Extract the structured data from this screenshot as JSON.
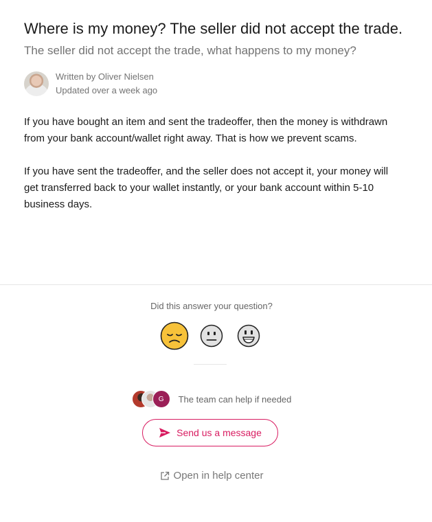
{
  "article": {
    "title": "Where is my money? The seller did not accept the trade.",
    "subtitle": "The seller did not accept the trade, what happens to my money?",
    "author_line": "Written by Oliver Nielsen",
    "updated_line": "Updated over a week ago",
    "paragraphs": [
      "If you have bought an item and sent the tradeoffer, then the money is withdrawn from your bank account/wallet right away. That is how we prevent scams.",
      "If you have sent the tradeoffer, and the seller does not accept it, your money will get transferred back to your wallet instantly, or your bank account within 5-10 business days."
    ]
  },
  "feedback": {
    "question": "Did this answer your question?",
    "options": [
      "disappointed-emoji",
      "neutral-emoji",
      "smiley-emoji"
    ]
  },
  "team": {
    "text": "The team can help if needed",
    "avatar_initial": "G"
  },
  "actions": {
    "send_message": "Send us a message",
    "open_help_center": "Open in help center"
  },
  "colors": {
    "accent": "#d81b60",
    "muted_text": "#737373"
  }
}
